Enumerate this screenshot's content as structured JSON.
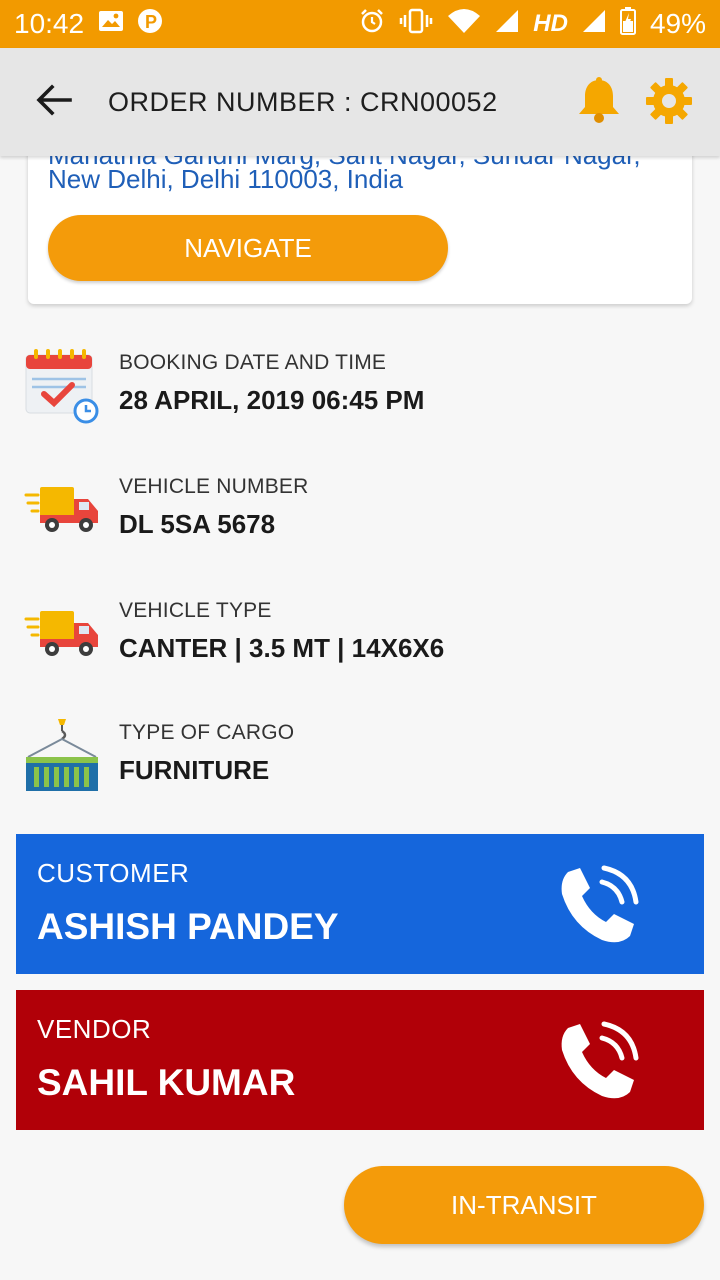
{
  "status_bar": {
    "time": "10:42",
    "network": "HD",
    "battery": "49%",
    "icons": [
      "image-icon",
      "p-app-icon",
      "alarm-icon",
      "vibrate-icon",
      "wifi-icon",
      "signal-icon",
      "battery-icon"
    ]
  },
  "header": {
    "title": "ORDER NUMBER : CRN00052",
    "icons": [
      "back-arrow-icon",
      "bell-icon",
      "gear-icon"
    ],
    "accent": "#f5a700"
  },
  "address": {
    "line1": "Mahatma Gandhi Marg, Sant Nagar, Sundar Nagar,",
    "line2": "New Delhi, Delhi 110003, India",
    "navigate_label": "NAVIGATE"
  },
  "details": [
    {
      "label": "BOOKING DATE AND TIME",
      "value": "28 APRIL, 2019  06:45 PM",
      "icon": "calendar-icon"
    },
    {
      "label": "VEHICLE NUMBER",
      "value": "DL 5SA 5678",
      "icon": "delivery-truck-icon"
    },
    {
      "label": "VEHICLE TYPE",
      "value": "CANTER | 3.5 MT | 14X6X6",
      "icon": "delivery-truck-icon"
    },
    {
      "label": "TYPE OF CARGO",
      "value": "FURNITURE",
      "icon": "cargo-container-icon"
    }
  ],
  "customer": {
    "role": "CUSTOMER",
    "name": "ASHISH PANDEY",
    "color": "#1566dc",
    "icon": "phone-call-icon"
  },
  "vendor": {
    "role": "VENDOR",
    "name": "SAHIL KUMAR",
    "color": "#b10008",
    "icon": "phone-call-icon"
  },
  "status_button": {
    "label": "IN-TRANSIT",
    "color": "#f49b0a"
  }
}
